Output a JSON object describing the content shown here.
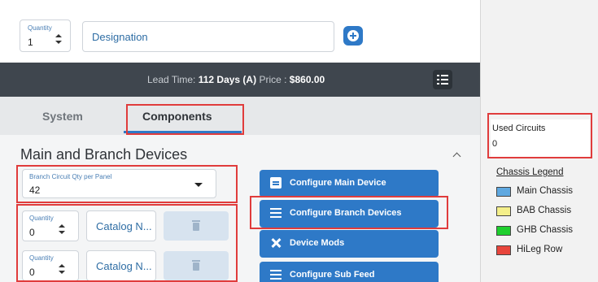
{
  "top": {
    "quantity_label": "Quantity",
    "quantity_value": "1",
    "designation_text": "Designation"
  },
  "lead_bar": {
    "lead_time_label": "Lead Time:",
    "lead_time_value": "112 Days (A)",
    "price_label": "Price :",
    "price_value": "$860.00"
  },
  "tabs": [
    {
      "label": "System",
      "active": false
    },
    {
      "label": "Components",
      "active": true
    }
  ],
  "section": {
    "title": "Main and Branch Devices",
    "branch_select": {
      "label": "Branch Circuit Qty per Panel",
      "value": "42"
    },
    "rows": [
      {
        "quantity_label": "Quantity",
        "quantity_value": "0",
        "catalog_text": "Catalog N..."
      },
      {
        "quantity_label": "Quantity",
        "quantity_value": "0",
        "catalog_text": "Catalog N..."
      }
    ],
    "buttons": [
      {
        "label": "Configure Main Device",
        "icon": "document-icon"
      },
      {
        "label": "Configure Branch Devices",
        "icon": "list-icon"
      },
      {
        "label": "Device Mods",
        "icon": "tools-icon"
      },
      {
        "label": "Configure Sub Feed",
        "icon": "list-icon"
      }
    ]
  },
  "sidebar": {
    "used_circuits_label": "Used Circuits",
    "used_circuits_value": "0",
    "legend_title": "Chassis Legend",
    "legend": [
      {
        "label": "Main Chassis",
        "color": "#5fa8e0"
      },
      {
        "label": "BAB Chassis",
        "color": "#f4ef8a"
      },
      {
        "label": "GHB Chassis",
        "color": "#1fcf2e"
      },
      {
        "label": "HiLeg Row",
        "color": "#e8453c"
      }
    ]
  },
  "colors": {
    "accent": "#2e79c7",
    "dark_bar": "#3f464e",
    "highlight": "#e03c3c"
  }
}
